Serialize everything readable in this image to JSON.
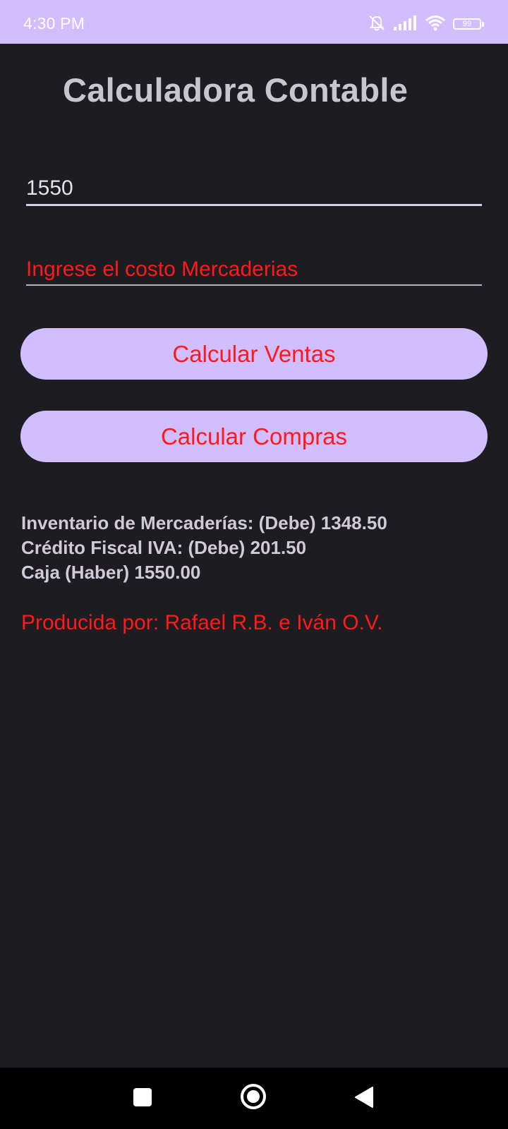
{
  "status_bar": {
    "time": "4:30 PM",
    "battery_level": "99",
    "icons": [
      "mute-icon",
      "signal-icon",
      "wifi-icon",
      "battery-icon"
    ]
  },
  "app": {
    "title": "Calculadora Contable"
  },
  "form": {
    "amount_value": "1550",
    "cost_placeholder": "Ingrese el costo Mercaderias",
    "cost_value": ""
  },
  "buttons": {
    "ventas_label": "Calcular Ventas",
    "compras_label": "Calcular Compras"
  },
  "results": {
    "line1": "Inventario de Mercaderías: (Debe) 1348.50",
    "line2": "Crédito Fiscal IVA: (Debe) 201.50",
    "line3": "Caja (Haber) 1550.00"
  },
  "credits": "Producida por: Rafael R.B. e Iván O.V.",
  "colors": {
    "accent": "#d1bdff",
    "background": "#1d1c21",
    "emphasis_text": "#ff1a1a"
  },
  "nav_bar": {
    "icons": [
      "recents-icon",
      "home-icon",
      "back-icon"
    ]
  }
}
